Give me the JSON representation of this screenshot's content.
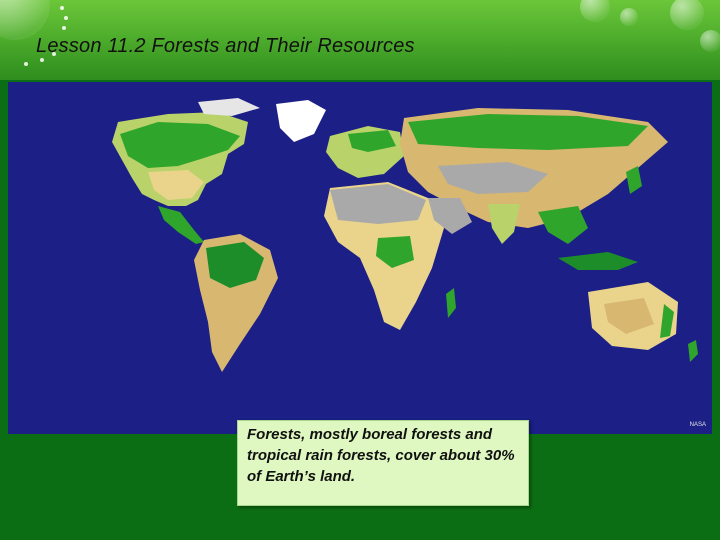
{
  "slide": {
    "title": "Lesson 11.2  Forests and Their Resources",
    "caption": "Forests, mostly boreal forests and tropical rain forests, cover about 30% of Earth’s land.",
    "map_credit": "NASA"
  },
  "map": {
    "subject": "World land cover map",
    "colors": {
      "ocean": "#1b1f86",
      "forest": "#2fa52c",
      "dense_forest": "#1d8d2a",
      "grassland": "#ead48c",
      "shrubland": "#d8b770",
      "desert": "#a9a9a9",
      "ice": "#ffffff",
      "cropland": "#b9d26a"
    }
  },
  "theme": {
    "header_green": "#4fae2c",
    "background_green": "#0c6e14",
    "caption_bg": "#dff7c0"
  }
}
